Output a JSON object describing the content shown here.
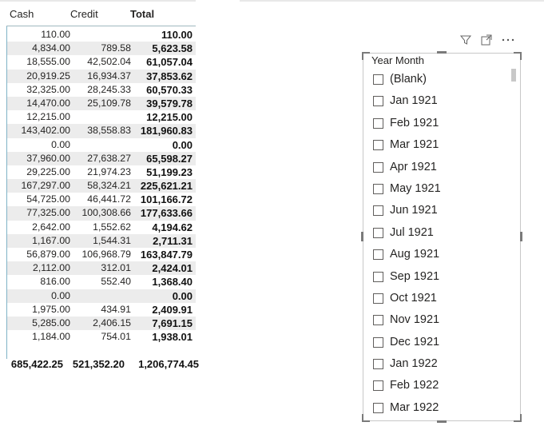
{
  "table": {
    "headers": {
      "cash": "Cash",
      "credit": "Credit",
      "total": "Total"
    },
    "rows": [
      {
        "cash": "110.00",
        "credit": "",
        "total": "110.00"
      },
      {
        "cash": "4,834.00",
        "credit": "789.58",
        "total": "5,623.58"
      },
      {
        "cash": "18,555.00",
        "credit": "42,502.04",
        "total": "61,057.04"
      },
      {
        "cash": "20,919.25",
        "credit": "16,934.37",
        "total": "37,853.62"
      },
      {
        "cash": "32,325.00",
        "credit": "28,245.33",
        "total": "60,570.33"
      },
      {
        "cash": "14,470.00",
        "credit": "25,109.78",
        "total": "39,579.78"
      },
      {
        "cash": "12,215.00",
        "credit": "",
        "total": "12,215.00"
      },
      {
        "cash": "143,402.00",
        "credit": "38,558.83",
        "total": "181,960.83"
      },
      {
        "cash": "0.00",
        "credit": "",
        "total": "0.00"
      },
      {
        "cash": "37,960.00",
        "credit": "27,638.27",
        "total": "65,598.27"
      },
      {
        "cash": "29,225.00",
        "credit": "21,974.23",
        "total": "51,199.23"
      },
      {
        "cash": "167,297.00",
        "credit": "58,324.21",
        "total": "225,621.21"
      },
      {
        "cash": "54,725.00",
        "credit": "46,441.72",
        "total": "101,166.72"
      },
      {
        "cash": "77,325.00",
        "credit": "100,308.66",
        "total": "177,633.66"
      },
      {
        "cash": "2,642.00",
        "credit": "1,552.62",
        "total": "4,194.62"
      },
      {
        "cash": "1,167.00",
        "credit": "1,544.31",
        "total": "2,711.31"
      },
      {
        "cash": "56,879.00",
        "credit": "106,968.79",
        "total": "163,847.79"
      },
      {
        "cash": "2,112.00",
        "credit": "312.01",
        "total": "2,424.01"
      },
      {
        "cash": "816.00",
        "credit": "552.40",
        "total": "1,368.40"
      },
      {
        "cash": "0.00",
        "credit": "",
        "total": "0.00"
      },
      {
        "cash": "1,975.00",
        "credit": "434.91",
        "total": "2,409.91"
      },
      {
        "cash": "5,285.00",
        "credit": "2,406.15",
        "total": "7,691.15"
      },
      {
        "cash": "1,184.00",
        "credit": "754.01",
        "total": "1,938.01"
      }
    ],
    "totals": {
      "cash": "685,422.25",
      "credit": "521,352.20",
      "total": "1,206,774.45"
    }
  },
  "slicer": {
    "title": "Year Month",
    "toolbar": {
      "filter_icon": "filter-icon",
      "focus_icon": "focus-mode-icon",
      "more_icon": "more-options-icon"
    },
    "items": [
      {
        "label": "(Blank)",
        "checked": false
      },
      {
        "label": "Jan 1921",
        "checked": false
      },
      {
        "label": "Feb 1921",
        "checked": false
      },
      {
        "label": "Mar 1921",
        "checked": false
      },
      {
        "label": "Apr 1921",
        "checked": false
      },
      {
        "label": "May 1921",
        "checked": false
      },
      {
        "label": "Jun 1921",
        "checked": false
      },
      {
        "label": "Jul 1921",
        "checked": false
      },
      {
        "label": "Aug 1921",
        "checked": false
      },
      {
        "label": "Sep 1921",
        "checked": false
      },
      {
        "label": "Oct 1921",
        "checked": false
      },
      {
        "label": "Nov 1921",
        "checked": false
      },
      {
        "label": "Dec 1921",
        "checked": false
      },
      {
        "label": "Jan 1922",
        "checked": false
      },
      {
        "label": "Feb 1922",
        "checked": false
      },
      {
        "label": "Mar 1922",
        "checked": false
      }
    ]
  },
  "colors": {
    "accent_rule": "#7fb2c6",
    "row_alt": "#ececec",
    "border": "#c8c8c8"
  }
}
